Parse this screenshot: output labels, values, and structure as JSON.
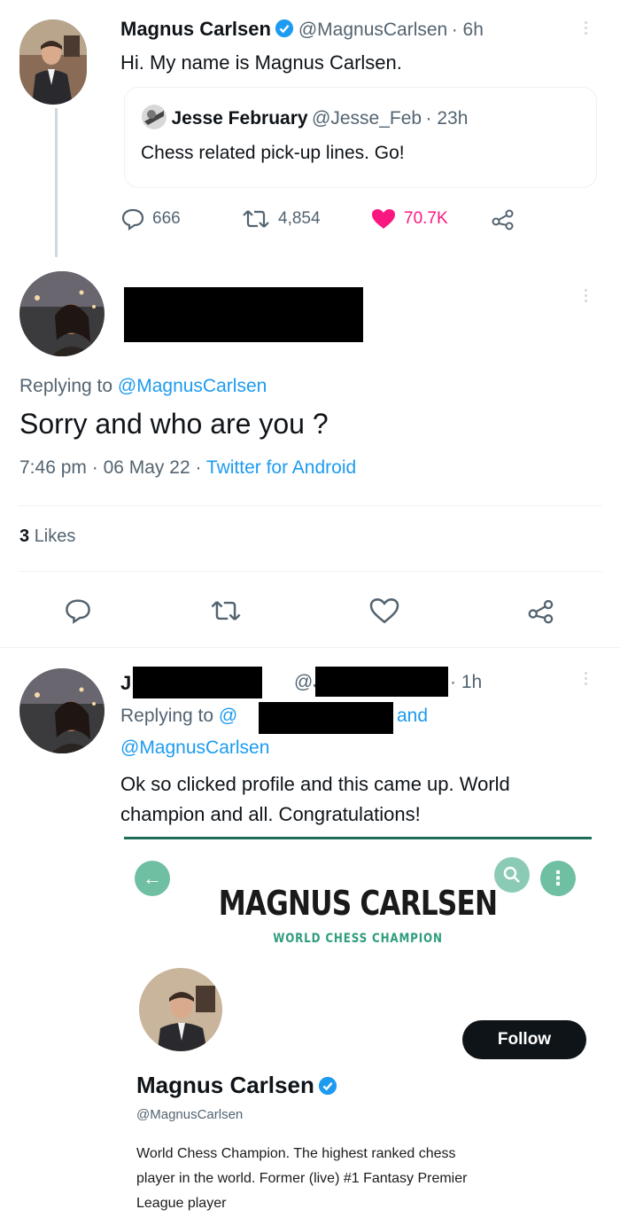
{
  "tweet1": {
    "author_name": "Magnus Carlsen",
    "author_handle": "@MagnusCarlsen",
    "time": "· 6h",
    "text": "Hi. My name is Magnus Carlsen.",
    "quote": {
      "author_name": "Jesse February",
      "author_handle": "@Jesse_Feb",
      "time": "· 23h",
      "text": "Chess related pick-up lines. Go!"
    },
    "replies": "666",
    "retweets": "4,854",
    "likes": "70.7K",
    "like_color": "#f91880"
  },
  "reply": {
    "replying_label": "Replying to",
    "replying_handle": "@MagnusCarlsen",
    "text": "Sorry and who are you ?",
    "time": "7:46 pm",
    "date": "06 May 22",
    "source": "Twitter for Android",
    "likes_count": "3",
    "likes_label": "Likes"
  },
  "tweet3": {
    "name_initial": "J",
    "handle_prefix": "@J",
    "time": "· 1h",
    "replying_label": "Replying to",
    "replying_prefix": "@",
    "and_label": "and",
    "replying_handle2": "@MagnusCarlsen",
    "text_line1": "Ok so clicked profile and this came up.  World",
    "text_line2": "champion and all. Congratulations!"
  },
  "embed": {
    "banner_title": "MAGNUS CARLSEN",
    "banner_subtitle": "WORLD CHESS CHAMPION",
    "follow_label": "Follow",
    "profile_name": "Magnus Carlsen",
    "profile_handle": "@MagnusCarlsen",
    "bio_line1": "World Chess Champion. The highest ranked chess",
    "bio_line2": "player in the world. Former (live) #1 Fantasy Premier",
    "bio_line3": "League player",
    "accent": "#2e9c7d"
  },
  "icons": {
    "verified": "verified-badge-icon",
    "reply": "reply-icon",
    "retweet": "retweet-icon",
    "like": "heart-icon",
    "share": "share-icon",
    "back": "back-arrow-icon",
    "search": "search-icon",
    "more": "more-icon"
  },
  "colors": {
    "link": "#1d9bf0",
    "secondary_text": "#536471",
    "verified": "#1d9bf0"
  }
}
